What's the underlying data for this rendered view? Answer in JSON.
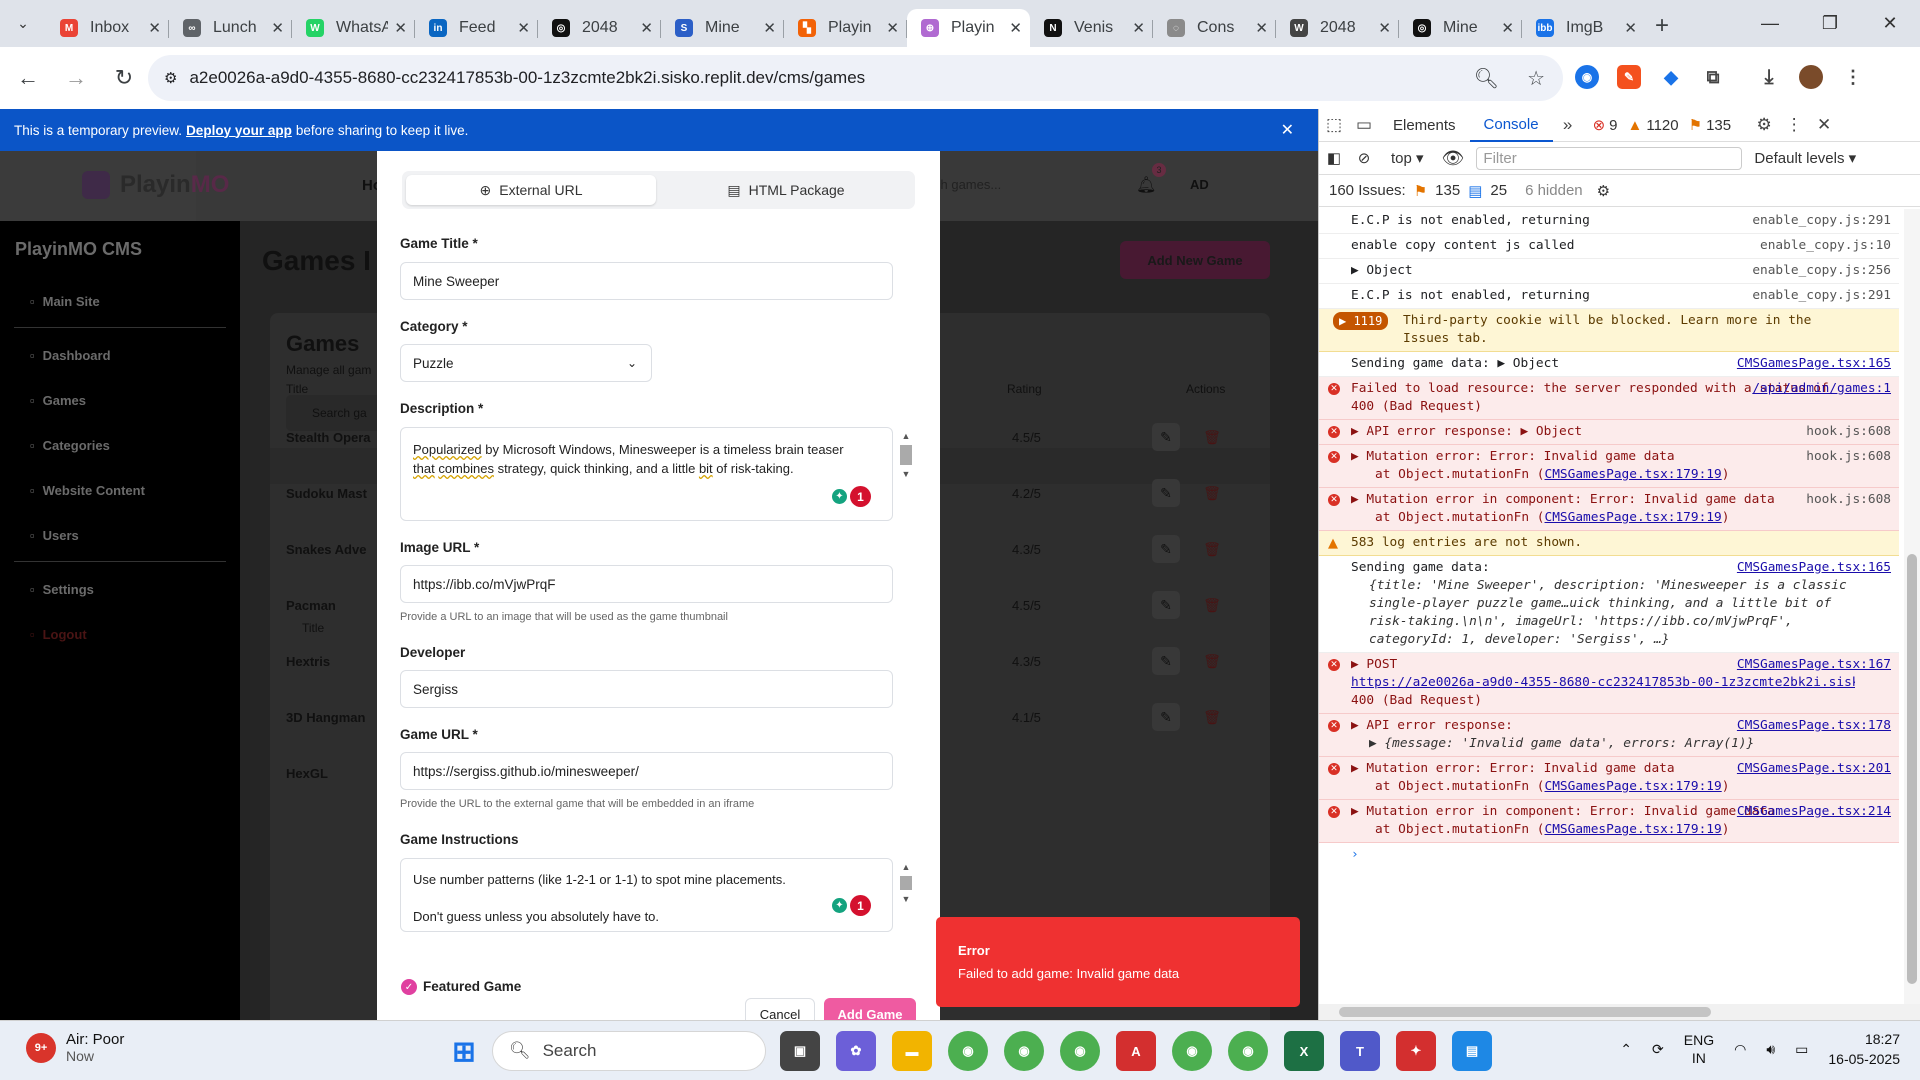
{
  "browser": {
    "tabs": [
      {
        "title": "Inbox",
        "icon": "gmail-icon",
        "color": "#ea4335",
        "glyph": "M"
      },
      {
        "title": "Lunch",
        "icon": "link-icon",
        "color": "#5f6368",
        "glyph": "∞"
      },
      {
        "title": "WhatsApp",
        "icon": "whatsapp-icon",
        "color": "#25d366",
        "glyph": "W"
      },
      {
        "title": "Feed",
        "icon": "linkedin-icon",
        "color": "#0a66c2",
        "glyph": "in"
      },
      {
        "title": "2048",
        "icon": "openai-icon",
        "color": "#111111",
        "glyph": "◎"
      },
      {
        "title": "Mine",
        "icon": "sbg-icon",
        "color": "#2c5fc7",
        "glyph": "S"
      },
      {
        "title": "Playin",
        "icon": "replit-icon",
        "color": "#f26207",
        "glyph": "▚"
      },
      {
        "title": "Playin",
        "icon": "game-controller-icon",
        "color": "#b06ad1",
        "glyph": "⊕",
        "active": true
      },
      {
        "title": "Venis",
        "icon": "notion-icon",
        "color": "#111111",
        "glyph": "N"
      },
      {
        "title": "Cons",
        "icon": "loader-icon",
        "color": "#8a8a8a",
        "glyph": "◌"
      },
      {
        "title": "2048",
        "icon": "wikipedia-icon",
        "color": "#444444",
        "glyph": "W"
      },
      {
        "title": "Mine",
        "icon": "openai-icon",
        "color": "#111111",
        "glyph": "◎"
      },
      {
        "title": "ImgB",
        "icon": "imgbb-icon",
        "color": "#1a73e8",
        "glyph": "ibb"
      }
    ],
    "url": "a2e0026a-a9d0-4355-8680-cc232417853b-00-1z3zcmte2bk2i.sisko.replit.dev/cms/games"
  },
  "banner": {
    "prefix": "This is a temporary preview.",
    "link": "Deploy your app",
    "suffix": "before sharing to keep it live."
  },
  "app": {
    "logo": "PlayinMO",
    "logo_a": "Playin",
    "logo_b": "MO",
    "cms_title": "PlayinMO CMS",
    "nav": [
      "Main Site",
      "Dashboard",
      "Games",
      "Categories",
      "Website Content",
      "Users",
      "Settings",
      "Logout"
    ],
    "header_search": "ch games...",
    "header_initials": "AD",
    "notif_count": "3",
    "header_home": "Ho",
    "page_title": "Games I",
    "add_new": "Add New Game",
    "card_title": "Games",
    "card_sub": "Manage all gam",
    "card_search": "Search ga",
    "columns": {
      "title": "Title",
      "rating": "Rating",
      "actions": "Actions"
    },
    "rows": [
      {
        "title": "Stealth Opera",
        "rating": "4.5/5"
      },
      {
        "title": "Sudoku Mast",
        "rating": "4.2/5"
      },
      {
        "title": "Snakes Adve",
        "rating": "4.3/5"
      },
      {
        "title": "Pacman",
        "rating": "4.5/5"
      },
      {
        "title": "Hextris",
        "rating": "4.3/5"
      },
      {
        "title": "3D Hangman",
        "rating": "4.1/5"
      },
      {
        "title": "HexGL",
        "rating": ""
      }
    ]
  },
  "modal": {
    "tab_external": "External URL",
    "tab_html": "HTML Package",
    "title_label": "Game Title *",
    "title_value": "Mine Sweeper",
    "category_label": "Category *",
    "category_value": "Puzzle",
    "description_label": "Description *",
    "description_parts": [
      "Popularized",
      " by Microsoft Windows, Minesweeper is a timeless brain teaser ",
      "that",
      " ",
      "combines",
      " strategy, quick thinking, and a little ",
      "bit",
      " of risk-taking."
    ],
    "image_label": "Image URL *",
    "image_value": "https://ibb.co/mVjwPrqF",
    "image_help": "Provide a URL to an image that will be used as the game thumbnail",
    "developer_label": "Developer",
    "developer_value": "Sergiss",
    "gameurl_label": "Game URL *",
    "gameurl_value": "https://sergiss.github.io/minesweeper/",
    "gameurl_help": "Provide the URL to the external game that will be embedded in an iframe",
    "instructions_label": "Game Instructions",
    "instructions_line1_a": "Use number patterns (",
    "instructions_line1_b": "like",
    " instructions_line1_c": "",
    "instructions_line1": "Use number patterns (like 1-2-1 or 1-1) to spot mine placements.",
    "instructions_line2": "Don't guess unless you absolutely have to.",
    "grammar_count": "1",
    "featured_label": "Featured Game",
    "cancel": "Cancel",
    "add": "Add Game"
  },
  "toast": {
    "title": "Error",
    "message": "Failed to add game: Invalid game data"
  },
  "devtools": {
    "tabs": [
      "Elements",
      "Console"
    ],
    "errors": "9",
    "warnings": "1120",
    "issues_flag": "135",
    "context": "top",
    "filter_placeholder": "Filter",
    "levels": "Default levels",
    "issues_label": "160 Issues:",
    "issues_a": "135",
    "issues_b": "25",
    "hidden": "6 hidden"
  },
  "console": [
    {
      "type": "log",
      "text": "E.C.P is not enabled, returning",
      "src": "enable_copy.js:291"
    },
    {
      "type": "log",
      "text": "enable copy content js called",
      "src": "enable_copy.js:10"
    },
    {
      "type": "log",
      "text": "▶ Object",
      "src": "enable_copy.js:256"
    },
    {
      "type": "log",
      "text": "E.C.P is not enabled, returning",
      "src": "enable_copy.js:291"
    },
    {
      "type": "warn",
      "count": "1119",
      "text": "Third-party cookie will be blocked. Learn more in the Issues tab.",
      "src": ""
    },
    {
      "type": "log",
      "text": "Sending game data:  ▶ Object",
      "src": "CMSGamesPage.tsx:165"
    },
    {
      "type": "err",
      "text": "Failed to load resource: the server responded with a status of 400 (Bad Request)",
      "src": "/api/admin/games:1"
    },
    {
      "type": "err",
      "text": "▶ API error response:  ▶ Object",
      "src": "hook.js:608"
    },
    {
      "type": "err",
      "text": "▶ Mutation error: Error: Invalid game data",
      "text2": "at Object.mutationFn (",
      "link": "CMSGamesPage.tsx:179:19",
      "src": "hook.js:608"
    },
    {
      "type": "err",
      "text": "▶ Mutation error in component: Error: Invalid game data",
      "text2": "at Object.mutationFn (",
      "link": "CMSGamesPage.tsx:179:19",
      "src": "hook.js:608"
    },
    {
      "type": "warnline",
      "text": "583 log entries are not shown.",
      "src": ""
    },
    {
      "type": "log",
      "text": "Sending game data:",
      "src": "CMSGamesPage.tsx:165",
      "obj": "{title: 'Mine Sweeper', description: 'Minesweeper is a classic single-player puzzle game…uick thinking, and a little bit of risk-taking.\\n\\n', imageUrl: 'https://ibb.co/mVjwPrqF', categoryId: 1, developer: 'Sergiss', …}"
    },
    {
      "type": "err",
      "text": "▶ POST",
      "src": "CMSGamesPage.tsx:167",
      "link": "https://a2e0026a-a9d0-4355-8680-cc232417853b-00-1z3zcmte2bk2i.sisko",
      "text3": "400 (Bad Request)"
    },
    {
      "type": "err",
      "text": "▶ API error response:",
      "src": "CMSGamesPage.tsx:178",
      "obj": "▶ {message: 'Invalid game data', errors: Array(1)}"
    },
    {
      "type": "err",
      "text": "▶ Mutation error: Error: Invalid game data",
      "text2": "at Object.mutationFn (",
      "link": "CMSGamesPage.tsx:179:19",
      "src": "CMSGamesPage.tsx:201"
    },
    {
      "type": "err",
      "text": "▶ Mutation error in component: Error: Invalid game data",
      "text2": "at Object.mutationFn (",
      "link": "CMSGamesPage.tsx:179:19",
      "src": "CMSGamesPage.tsx:214"
    }
  ],
  "taskbar": {
    "weather_badge": "9+",
    "weather_title": "Air: Poor",
    "weather_sub": "Now",
    "search": "Search",
    "lang": "ENG",
    "region": "IN",
    "time": "18:27",
    "date": "16-05-2025"
  }
}
